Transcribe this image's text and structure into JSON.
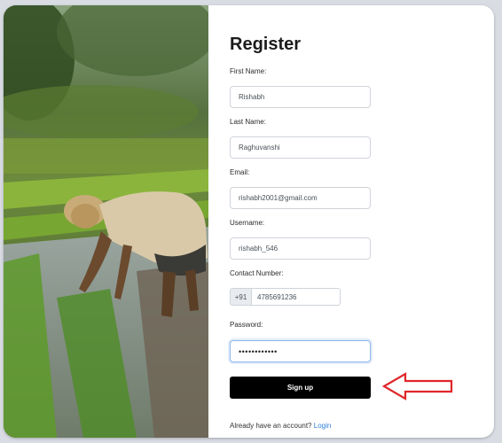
{
  "form": {
    "title": "Register",
    "first_name": {
      "label": "First Name:",
      "value": "Rishabh"
    },
    "last_name": {
      "label": "Last Name:",
      "value": "Raghuvanshi"
    },
    "email": {
      "label": "Email:",
      "value": "rishabh2001@gmail.com"
    },
    "username": {
      "label": "Username:",
      "value": "rishabh_546"
    },
    "contact": {
      "label": "Contact Number:",
      "prefix": "+91",
      "value": "4785691236"
    },
    "password": {
      "label": "Password:",
      "value": "••••••••••••"
    },
    "signup_label": "Sign up",
    "footer_text": "Already have an account?",
    "login_link": "Login"
  },
  "colors": {
    "button": "#000000",
    "link": "#2f7fd8",
    "focus_border": "#8db8e8",
    "annotation_arrow": "#e0262a"
  }
}
